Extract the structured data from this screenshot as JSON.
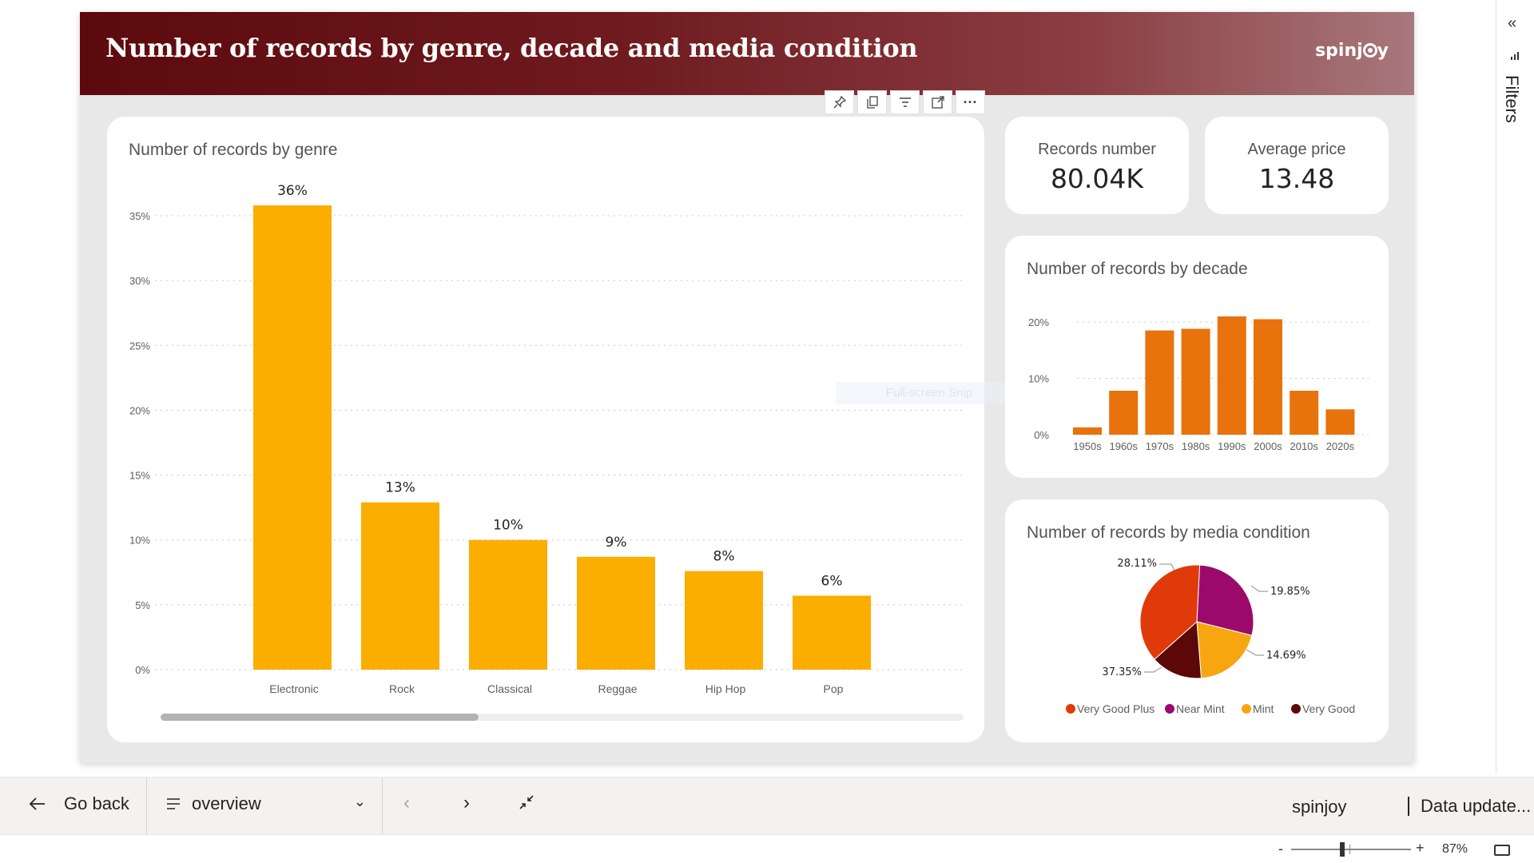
{
  "report": {
    "title": "Number of records by genre, decade and media condition",
    "brand": "spinjoy",
    "header_colors": [
      "#5c0a0e",
      "#a8787c"
    ]
  },
  "visual_toolbar": [
    "pin-icon",
    "copy-icon",
    "filter-icon",
    "focus-mode-icon",
    "more-options-icon"
  ],
  "snip_overlay": "Full-screen Snip",
  "kpis": {
    "records": {
      "label": "Records number",
      "value": "80.04K"
    },
    "price": {
      "label": "Average price",
      "value": "13.48"
    }
  },
  "chart_data": [
    {
      "type": "bar",
      "title": "Number of records by genre",
      "categories": [
        "Electronic",
        "Rock",
        "Classical",
        "Reggae",
        "Hip Hop",
        "Pop"
      ],
      "values": [
        35.8,
        12.9,
        10.0,
        8.7,
        7.6,
        5.7
      ],
      "data_labels": [
        "36%",
        "13%",
        "10%",
        "9%",
        "8%",
        "6%"
      ],
      "yticks": [
        "0%",
        "5%",
        "10%",
        "15%",
        "20%",
        "25%",
        "30%",
        "35%"
      ],
      "ylim": [
        0,
        35
      ],
      "color": "#fbad00",
      "grid": true
    },
    {
      "type": "bar",
      "title": "Number of records by decade",
      "categories": [
        "1950s",
        "1960s",
        "1970s",
        "1980s",
        "1990s",
        "2000s",
        "2010s",
        "2020s"
      ],
      "values": [
        1.3,
        7.8,
        18.5,
        18.8,
        21.0,
        20.5,
        7.8,
        4.5
      ],
      "yticks": [
        "0%",
        "10%",
        "20%"
      ],
      "ylim": [
        0,
        20
      ],
      "color": "#e8720c",
      "grid": true
    },
    {
      "type": "pie",
      "title": "Number of records by media condition",
      "labels": [
        "Very Good Plus",
        "Near Mint",
        "Mint",
        "Very Good"
      ],
      "values": [
        37.35,
        28.11,
        19.85,
        14.69
      ],
      "data_labels": [
        "37.35%",
        "28.11%",
        "19.85%",
        "14.69%"
      ],
      "colors": [
        "#e03a0a",
        "#9b0a6b",
        "#f7a60f",
        "#5c0708"
      ],
      "legend_position": "bottom"
    }
  ],
  "filters_pane": {
    "label": "Filters"
  },
  "nav": {
    "go_back": "Go back",
    "page": "overview",
    "org": "spinjoy",
    "data_update": "Data update..."
  },
  "status": {
    "zoom_minus": "-",
    "zoom_plus": "+",
    "zoom": "87%"
  }
}
